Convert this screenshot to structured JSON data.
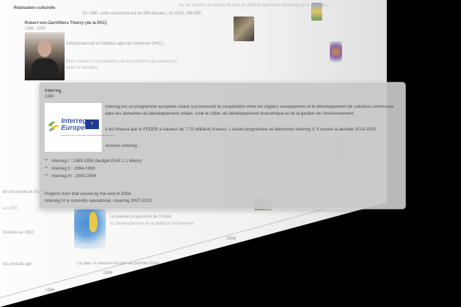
{
  "background": {
    "header_text": "Réalisation culturelle",
    "ghost_line_1": "En 1990, cette couverture est de 888 dossiers, en 2013, 289 000.",
    "ghost_line_2": "Au 1er Janvier, un réseau de plus de 1000 programmes d'échange pour Erasmus.",
    "profile_name": "Robert-von-ZanVilliers Thierry (de la PAC)",
    "profile_years": "1989, 1993",
    "profile_text_1": "Indépendant de la Politique agricole commune (PAC).",
    "profile_text_2": "Étant conduit à une limitation de la production des semences.",
    "profile_text_3": "dans ce domaine.",
    "left_text_1": "de l'économie et d'import",
    "left_text_2": "en 1990",
    "left_text_3": "d'entrée au 1992",
    "left_text_4": "les produits agri",
    "map_caption_1": "Le premier programme de l'Union,",
    "map_caption_2": "du développement de la politique européenne.",
    "map_caption_3": "Ce plan, la mesure est bien au premier d'une."
  },
  "axis_years": [
    "2000",
    "2006",
    "1999",
    "1989"
  ],
  "card": {
    "title": "Interreg",
    "year": "1989",
    "logo": {
      "word_top": "Interreg",
      "word_bottom": "Europe",
      "tagline": "European Union | European Regional Development Fund",
      "eu_flag_icon": "eu-flag-icon"
    },
    "paragraph_1": "Interreg est un programme européen visant à promouvoir la coopération entre les régions européennes et le développement de solutions communes dans les domaines du développement urbain, rural et côtier, du développement économique et de la gestion de l'environnement.",
    "paragraph_2": "Il est financé par le FEDER à hauteur de 7,75 milliards d'euros. L'actuel programme se dénomme Interreg V, il couvre la période 2014-2020.",
    "anciens_label": "Anciens interreg :",
    "programs": [
      "Interreg I : 1989-1993 (budget EUR 1.1 billion)",
      "Interreg II : 1994-1999",
      "Interreg III : 2000-2006"
    ],
    "note_1": "Projects from that closed by the end of 2008.",
    "note_2": "Interreg IV is currently operational, covering 2007-2013."
  }
}
